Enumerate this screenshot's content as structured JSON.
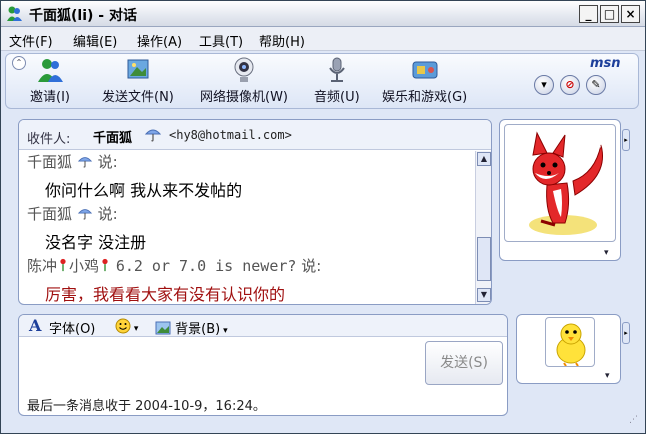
{
  "window": {
    "title": "千面狐(li) - 对话",
    "controls": [
      "_",
      "□",
      "×"
    ]
  },
  "menu": {
    "items": [
      "文件(F)",
      "编辑(E)",
      "操作(A)",
      "工具(T)",
      "帮助(H)"
    ]
  },
  "toolbar": {
    "buttons": [
      {
        "label": "邀请(I)",
        "icon": "invite-people-icon"
      },
      {
        "label": "发送文件(N)",
        "icon": "send-file-icon"
      },
      {
        "label": "网络摄像机(W)",
        "icon": "webcam-icon"
      },
      {
        "label": "音频(U)",
        "icon": "microphone-icon"
      },
      {
        "label": "娱乐和游戏(G)",
        "icon": "games-icon"
      }
    ],
    "brand": "msn"
  },
  "conversation": {
    "to_label": "收件人:",
    "to_name": "千面狐",
    "to_email": "<hy8@hotmail.com>",
    "messages": [
      {
        "speaker": "千面狐",
        "says": "说:",
        "text": "你问什么啊 我从来不发帖的"
      },
      {
        "speaker": "千面狐",
        "says": "说:",
        "text": "没名字 没注册"
      },
      {
        "speaker_a": "陈冲",
        "speaker_b": "小鸡",
        "speaker_c": "6.2 or 7.0 is newer?",
        "says": "说:",
        "text": "厉害，我看看大家有没有认识你的"
      }
    ]
  },
  "compose": {
    "font_label": "字体(O)",
    "background_label": "背景(B)",
    "send_label": "发送(S)",
    "input_value": "",
    "status": "最后一条消息收于 2004-10-9，16:24。"
  },
  "colors": {
    "accent": "#1d3f9a",
    "red_text": "#a01010",
    "panel_bg": "#dfe7f6"
  }
}
